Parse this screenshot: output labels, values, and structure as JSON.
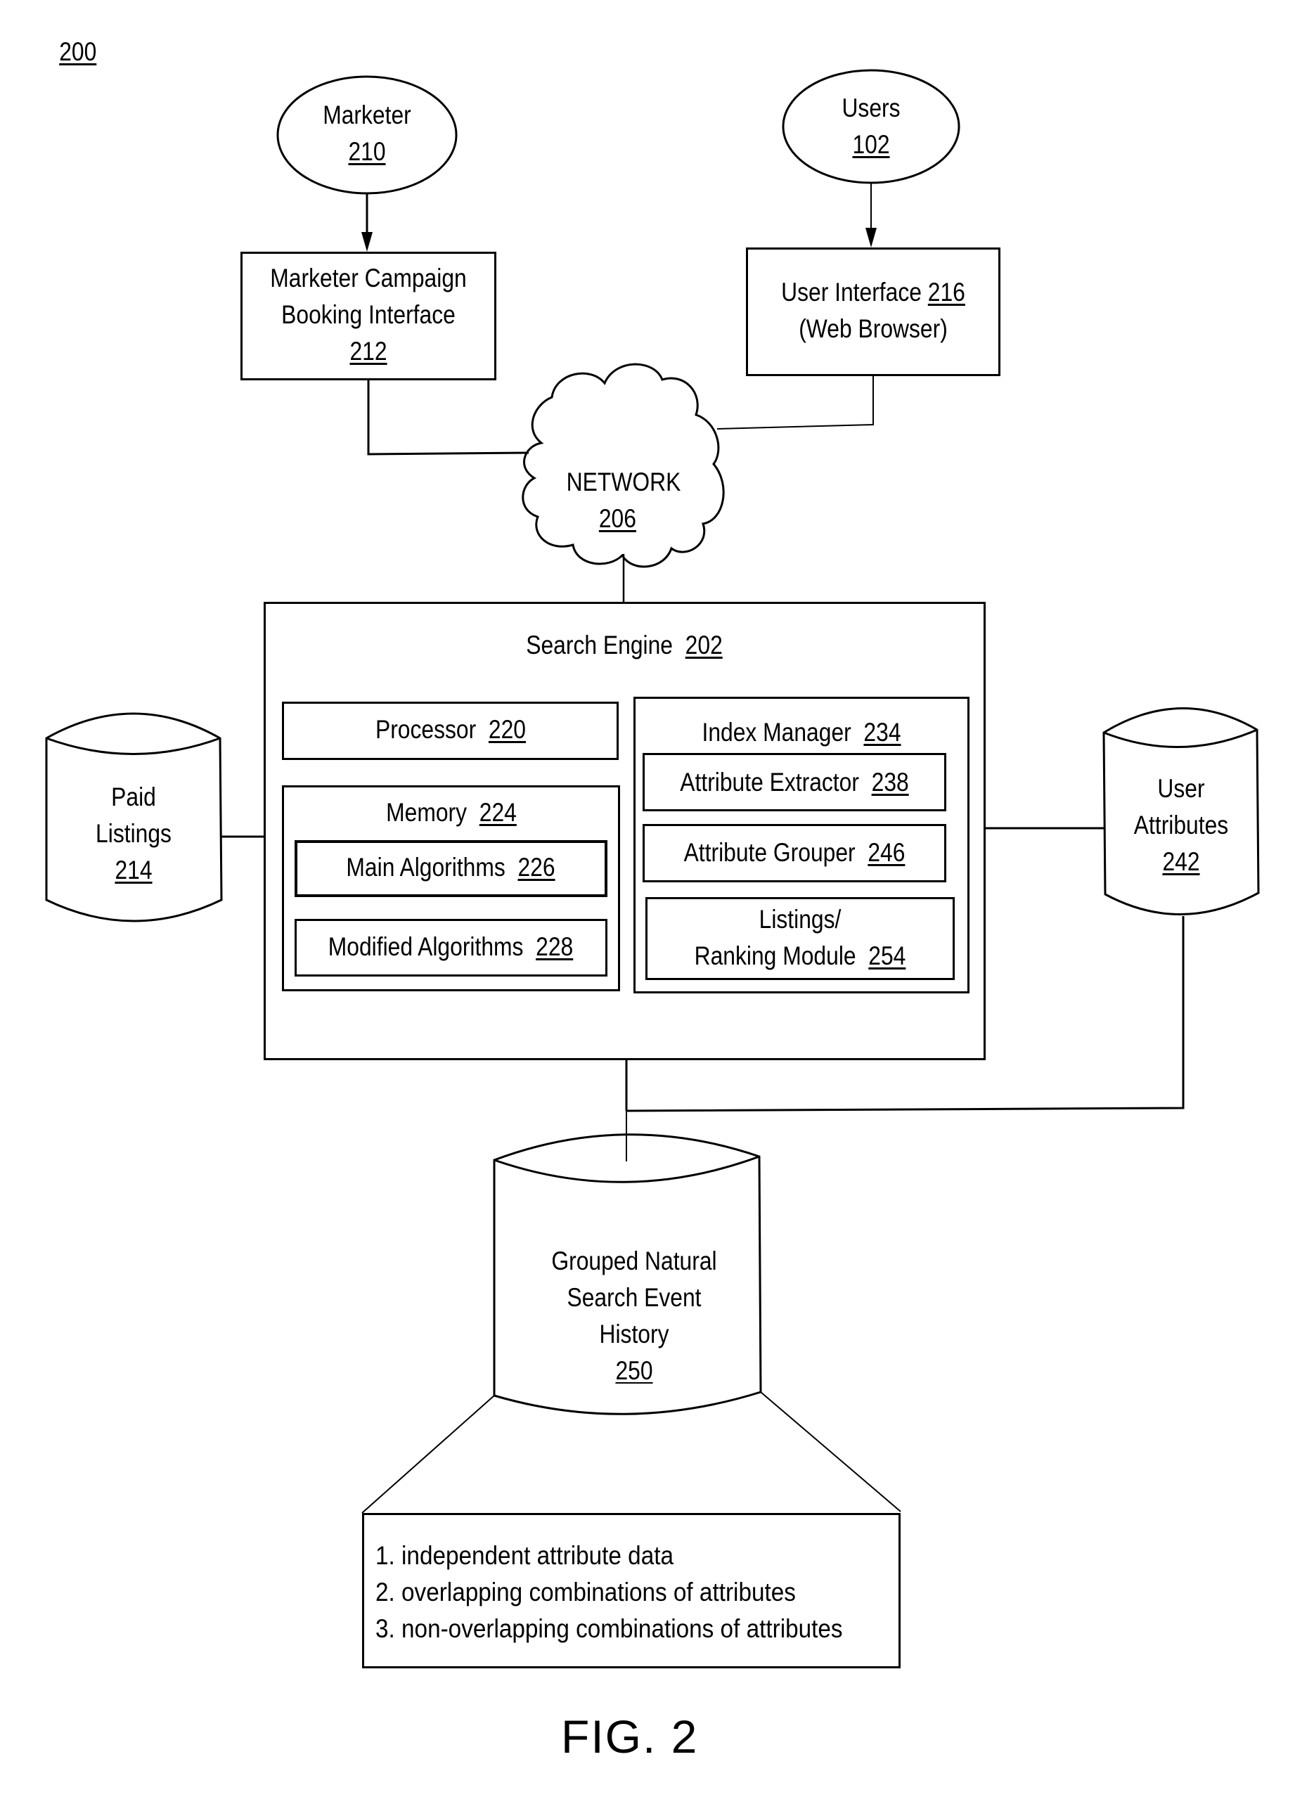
{
  "figure": {
    "ref": "200",
    "caption": "FIG. 2"
  },
  "nodes": {
    "marketer": {
      "label": "Marketer",
      "ref": "210"
    },
    "users": {
      "label": "Users",
      "ref": "102"
    },
    "booking": {
      "line1": "Marketer Campaign",
      "line2": "Booking Interface",
      "ref": "212"
    },
    "user_interface": {
      "label": "User Interface",
      "ref": "216",
      "line2": "(Web Browser)"
    },
    "network": {
      "label": "NETWORK",
      "ref": "206"
    },
    "search_engine": {
      "label": "Search Engine",
      "ref": "202"
    },
    "processor": {
      "label": "Processor",
      "ref": "220"
    },
    "memory": {
      "label": "Memory",
      "ref": "224"
    },
    "main_algorithms": {
      "label": "Main Algorithms",
      "ref": "226"
    },
    "modified_algorithms": {
      "label": "Modified Algorithms",
      "ref": "228"
    },
    "index_manager": {
      "label": "Index Manager",
      "ref": "234"
    },
    "attribute_extractor": {
      "label": "Attribute Extractor",
      "ref": "238"
    },
    "attribute_grouper": {
      "label": "Attribute Grouper",
      "ref": "246"
    },
    "listings_ranking": {
      "line1": "Listings/",
      "line2": "Ranking Module",
      "ref": "254"
    },
    "paid_listings": {
      "line1": "Paid",
      "line2": "Listings",
      "ref": "214"
    },
    "user_attributes": {
      "line1": "User",
      "line2": "Attributes",
      "ref": "242"
    },
    "grouped_history": {
      "line1": "Grouped Natural",
      "line2": "Search Event",
      "line3": "History",
      "ref": "250"
    }
  },
  "grouped_history_details": {
    "items": [
      "1. independent attribute data",
      "2. overlapping combinations of attributes",
      "3. non-overlapping combinations of attributes"
    ]
  }
}
